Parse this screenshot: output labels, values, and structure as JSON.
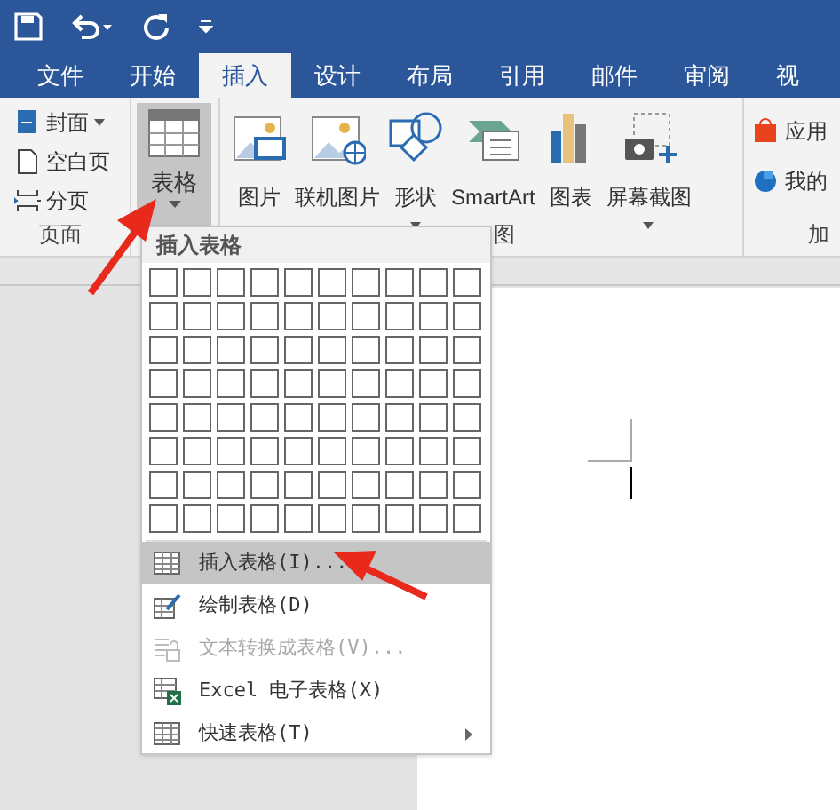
{
  "tabs": [
    {
      "label": "文件",
      "selected": false
    },
    {
      "label": "开始",
      "selected": false
    },
    {
      "label": "插入",
      "selected": true
    },
    {
      "label": "设计",
      "selected": false
    },
    {
      "label": "布局",
      "selected": false
    },
    {
      "label": "引用",
      "selected": false
    },
    {
      "label": "邮件",
      "selected": false
    },
    {
      "label": "审阅",
      "selected": false
    },
    {
      "label": "视",
      "selected": false
    }
  ],
  "ribbon": {
    "pages_group": {
      "items": [
        {
          "label": "封面",
          "kind": "cover",
          "dropdown": true
        },
        {
          "label": "空白页",
          "kind": "blank",
          "dropdown": false
        },
        {
          "label": "分页",
          "kind": "break",
          "dropdown": false
        }
      ],
      "label": "页面"
    },
    "table_button": {
      "label": "表格",
      "pressed": true
    },
    "illustrations": {
      "buttons": [
        {
          "label": "图片",
          "kind": "picture",
          "dropdown": false
        },
        {
          "label": "联机图片",
          "kind": "online",
          "dropdown": false
        },
        {
          "label": "形状",
          "kind": "shapes",
          "dropdown": true
        },
        {
          "label": "SmartArt",
          "kind": "smartart",
          "dropdown": false
        },
        {
          "label": "图表",
          "kind": "chart",
          "dropdown": false
        },
        {
          "label": "屏幕截图",
          "kind": "screenshot",
          "dropdown": true
        }
      ],
      "label": "图"
    },
    "addins": {
      "items": [
        {
          "label": "应用",
          "kind": "store"
        },
        {
          "label": "我的",
          "kind": "addins"
        }
      ],
      "label": "加"
    }
  },
  "menu": {
    "header": "插入表格",
    "items": [
      {
        "label": "插入表格(I)...",
        "kind": "table",
        "selected": true,
        "disabled": false,
        "submenu": false
      },
      {
        "label": "绘制表格(D)",
        "kind": "draw",
        "selected": false,
        "disabled": false,
        "submenu": false
      },
      {
        "label": "文本转换成表格(V)...",
        "kind": "convert",
        "selected": false,
        "disabled": true,
        "submenu": false
      },
      {
        "label": "Excel 电子表格(X)",
        "kind": "excel",
        "selected": false,
        "disabled": false,
        "submenu": false
      },
      {
        "label": "快速表格(T)",
        "kind": "table",
        "selected": false,
        "disabled": false,
        "submenu": true
      }
    ]
  }
}
